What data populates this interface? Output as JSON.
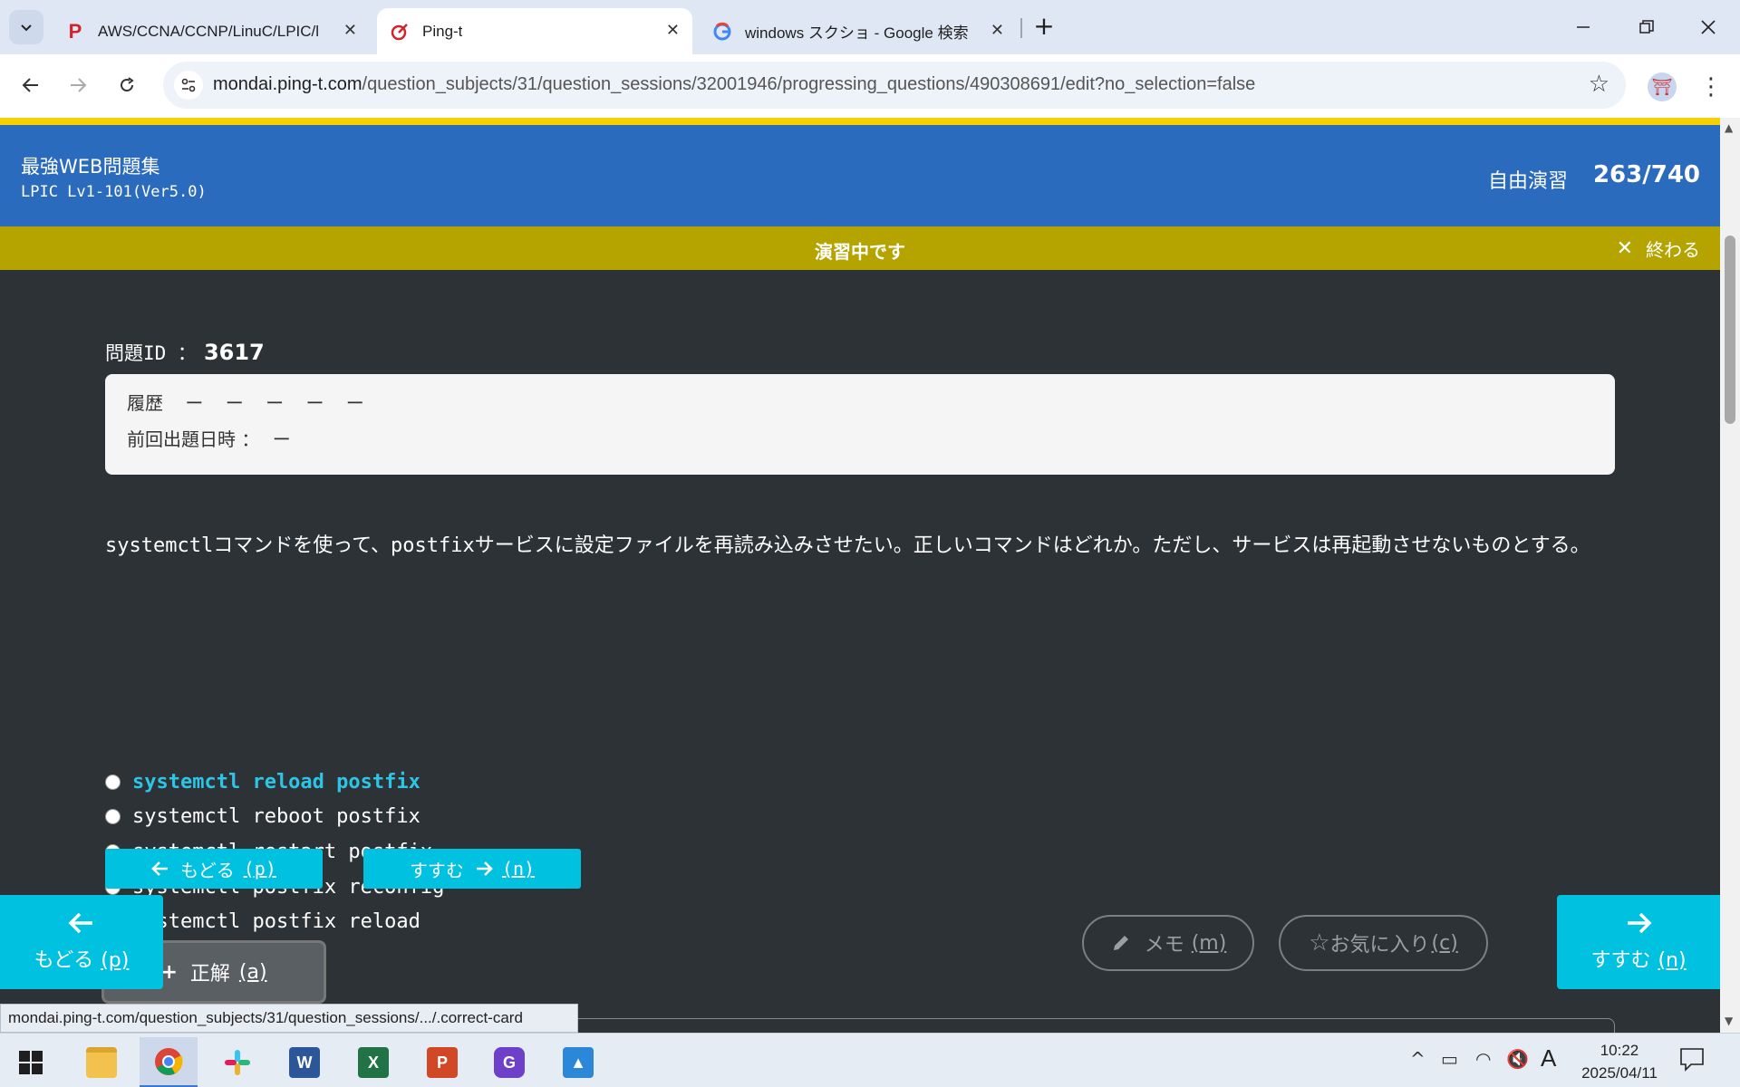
{
  "browser": {
    "tabs": [
      {
        "title": "AWS/CCNA/CCNP/LinuC/LPIC/l",
        "active": false
      },
      {
        "title": "Ping-t",
        "active": true
      },
      {
        "title": "windows スクショ - Google 検索",
        "active": false
      }
    ],
    "url_domain": "mondai.ping-t.com",
    "url_path": "/question_subjects/31/question_sessions/32001946/progressing_questions/490308691/edit?no_selection=false",
    "status_url": "mondai.ping-t.com/question_subjects/31/question_sessions/.../.correct-card"
  },
  "header": {
    "brand": "最強WEB問題集",
    "course": "LPIC Lv1-101(Ver5.0)",
    "mode": "自由演習",
    "progress": "263/740"
  },
  "status_bar": {
    "text": "演習中です",
    "end_label": "終わる"
  },
  "question": {
    "id_label": "問題ID ：",
    "id": "3617",
    "history_label": "履歴",
    "history": [
      "ー",
      "ー",
      "ー",
      "ー",
      "ー"
    ],
    "last_date_label": "前回出題日時 ：",
    "last_date": "ー",
    "text_parts": [
      {
        "text": "systemctl",
        "mono": true
      },
      {
        "text": "コマンドを使って、",
        "mono": false
      },
      {
        "text": "postfix",
        "mono": true
      },
      {
        "text": "サービスに設定ファイルを再読み込みさせたい。正しいコマンドはどれか。ただし、サービスは再起動させないものとする。",
        "mono": false
      }
    ],
    "options": [
      "systemctl reload postfix",
      "systemctl reboot postfix",
      "systemctl restart postfix",
      "systemctl postfix reconfig",
      "systemctl postfix reload"
    ],
    "highlighted_option": 0
  },
  "buttons": {
    "back_label": "もどる",
    "back_key": "(p)",
    "next_label": "すすむ",
    "next_key": "(n)",
    "answer_label": "正解",
    "answer_key": "(a)",
    "memo_label": "メモ",
    "memo_key": "(m)",
    "fav_label": "お気に入り",
    "fav_key": "(c)"
  },
  "taskbar": {
    "ime": "A",
    "time": "10:22",
    "date": "2025/04/11"
  },
  "colors": {
    "header_blue": "#2b6bbd",
    "status_olive": "#b5a400",
    "accent_cyan": "#00c2e0",
    "page_bg": "#2d3236"
  }
}
